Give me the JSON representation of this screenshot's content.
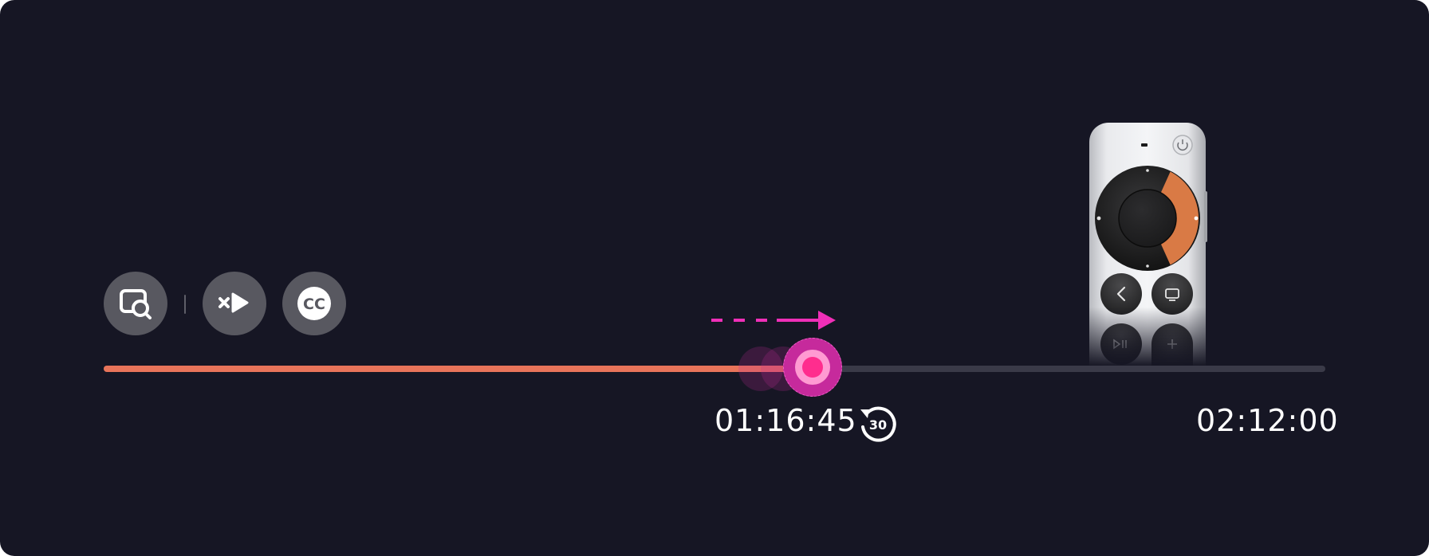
{
  "player": {
    "current_time": "01:16:45",
    "total_time": "02:12:00",
    "progress_fraction": 0.58,
    "skip_back_label": "30"
  },
  "controls": {
    "buttons": [
      {
        "icon": "scene-search-icon"
      },
      {
        "icon": "skip-intro-icon"
      },
      {
        "icon": "closed-captions-icon",
        "label": "CC"
      }
    ]
  },
  "colors": {
    "background": "#161624",
    "progress": "#e8745a",
    "track": "#3a3a48",
    "scrubber": "#c62a9c",
    "arrow": "#f02fb8",
    "remote_highlight": "#d97a45"
  }
}
